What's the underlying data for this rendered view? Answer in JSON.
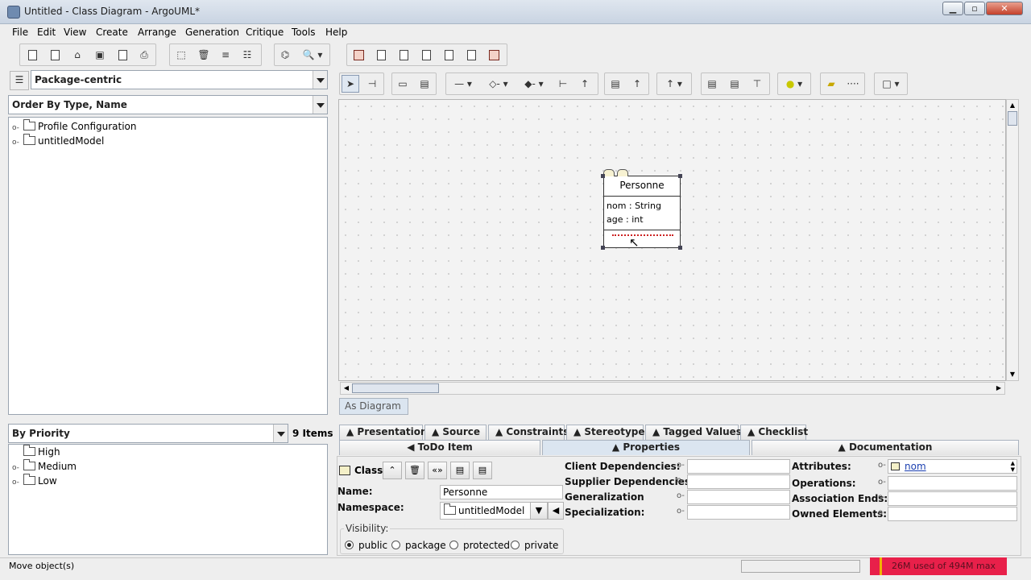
{
  "window": {
    "title": "Untitled - Class Diagram - ArgoUML*"
  },
  "menu": [
    "File",
    "Edit",
    "View",
    "Create",
    "Arrange",
    "Generation",
    "Critique",
    "Tools",
    "Help"
  ],
  "explorer": {
    "perspective": "Package-centric",
    "order": "Order By Type, Name",
    "tree": [
      {
        "label": "Profile Configuration",
        "icon": "folder-icon"
      },
      {
        "label": "untitledModel",
        "icon": "package-icon"
      }
    ]
  },
  "todo": {
    "grouping": "By Priority",
    "count": "9 Items",
    "tree": [
      {
        "label": "High",
        "expandable": false
      },
      {
        "label": "Medium",
        "expandable": true
      },
      {
        "label": "Low",
        "expandable": true
      }
    ]
  },
  "diagram": {
    "tab": "As Diagram",
    "class": {
      "name": "Personne",
      "attributes": [
        "nom : String",
        "age : int"
      ]
    }
  },
  "details": {
    "tabs_row1": [
      "Presentation",
      "Source",
      "Constraints",
      "Stereotype",
      "Tagged Values",
      "Checklist"
    ],
    "tabs_row2": [
      "ToDo Item",
      "Properties",
      "Documentation"
    ],
    "active_tab": "Properties",
    "element_type": "Class",
    "name_label": "Name:",
    "name_value": "Personne",
    "namespace_label": "Namespace:",
    "namespace_value": "untitledModel",
    "visibility_label": "Visibility:",
    "visibility_options": [
      "public",
      "package",
      "protected",
      "private"
    ],
    "visibility_selected": "public",
    "mid_labels": [
      "Client Dependencies:",
      "Supplier Dependencies:",
      "Generalization",
      "Specialization:"
    ],
    "right_labels": [
      "Attributes:",
      "Operations:",
      "Association Ends:",
      "Owned Elements:"
    ],
    "attributes_first": "nom"
  },
  "status": {
    "message": "Move object(s)",
    "memory": "26M used of 494M max"
  }
}
